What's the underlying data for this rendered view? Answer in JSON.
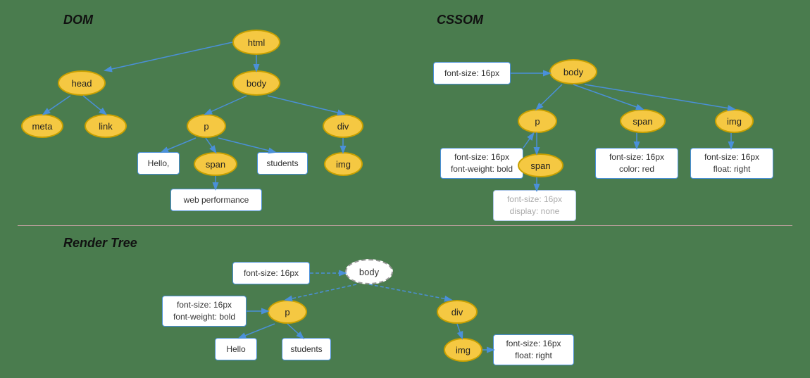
{
  "sections": {
    "dom": {
      "label": "DOM"
    },
    "cssom": {
      "label": "CSSOM"
    },
    "render_tree": {
      "label": "Render Tree"
    }
  },
  "dom_nodes": {
    "html": "html",
    "head": "head",
    "body": "body",
    "meta": "meta",
    "link": "link",
    "p": "p",
    "span": "span",
    "div": "div",
    "img": "img",
    "hello": "Hello,",
    "students": "students",
    "web_performance": "web performance"
  },
  "cssom_nodes": {
    "body": "body",
    "p": "p",
    "span_child": "span",
    "span": "span",
    "img": "img",
    "font_size_body": "font-size: 16px",
    "font_size_p": "font-size: 16px\nfont-weight: bold",
    "font_size_span_child": "font-size: 16px\ndisplay: none",
    "font_size_span": "font-size: 16px\ncolor: red",
    "font_size_img": "font-size: 16px\nfloat: right"
  },
  "render_nodes": {
    "body": "body",
    "p": "p",
    "div": "div",
    "img": "img",
    "font_size_body": "font-size: 16px",
    "font_size_p": "font-size: 16px\nfont-weight: bold",
    "font_size_img": "font-size: 16px\nfloat: right",
    "hello": "Hello",
    "students": "students"
  }
}
